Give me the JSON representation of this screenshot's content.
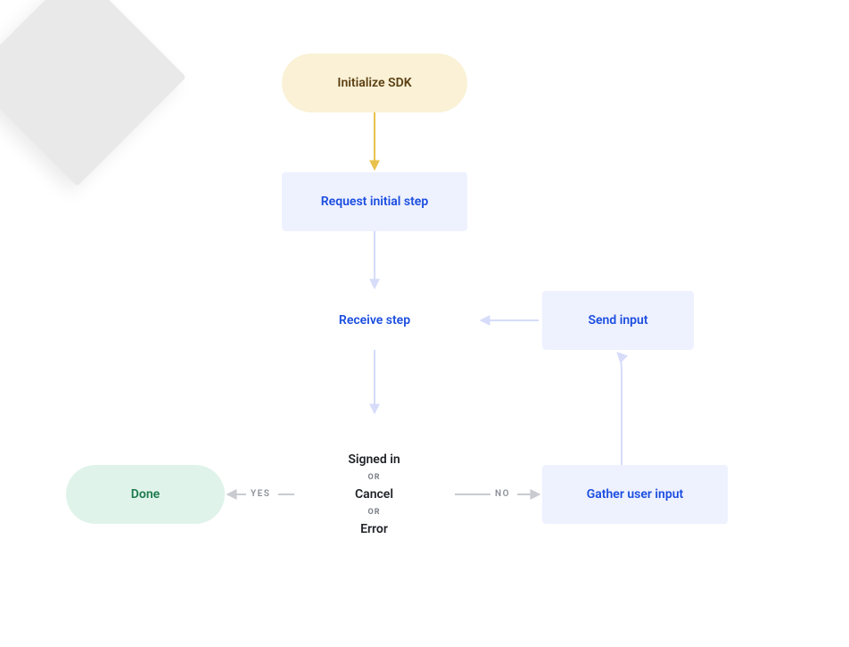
{
  "nodes": {
    "init": {
      "label": "Initialize SDK"
    },
    "request": {
      "label": "Request initial step"
    },
    "receive": {
      "label": "Receive step"
    },
    "send": {
      "label": "Send input"
    },
    "gather": {
      "label": "Gather user input"
    },
    "done": {
      "label": "Done"
    },
    "decision": {
      "line1": "Signed in",
      "sep": "OR",
      "line2": "Cancel",
      "line3": "Error"
    }
  },
  "edges": {
    "yes": "YES",
    "no": "NO"
  },
  "colors": {
    "yellowArrow": "#e8c24c",
    "lightBlueArrow": "#d6dcf9",
    "greyArrow": "#c9cbd1"
  }
}
